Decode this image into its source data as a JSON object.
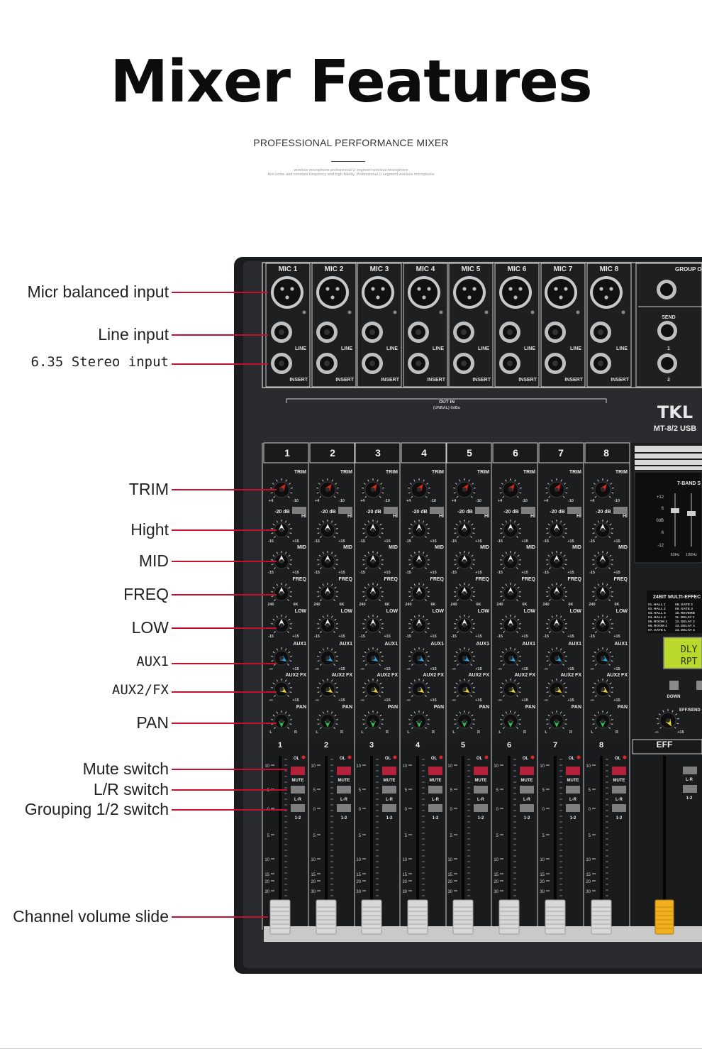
{
  "header": {
    "title": "Mixer Features",
    "subtitle": "PROFESSIONAL PERFORMANCE MIXER",
    "tiny_line_1": "wireless microphone professional U segment wireless microphone",
    "tiny_line_2": "Anti noise and constant frequency and high fidelity, Professional U segment wireless microphone"
  },
  "callouts": [
    {
      "label": "Micr balanced input"
    },
    {
      "label": "Line input"
    },
    {
      "label": "6.35 Stereo input"
    },
    {
      "label": "TRIM"
    },
    {
      "label": "Hight"
    },
    {
      "label": "MID"
    },
    {
      "label": "FREQ"
    },
    {
      "label": "LOW"
    },
    {
      "label": "AUX1"
    },
    {
      "label": "AUX2/FX"
    },
    {
      "label": "PAN"
    },
    {
      "label": "Mute switch"
    },
    {
      "label": "L/R switch"
    },
    {
      "label": "Grouping 1/2 switch"
    },
    {
      "label": "Channel volume slide"
    }
  ],
  "mixer": {
    "brand": "TKL",
    "model": "MT-8/2 USB",
    "mic_labels": [
      "MIC 1",
      "MIC 2",
      "MIC 3",
      "MIC 4",
      "MIC 5",
      "MIC 6",
      "MIC 7",
      "MIC 8"
    ],
    "channel_numbers": [
      "1",
      "2",
      "3",
      "4",
      "5",
      "6",
      "7",
      "8"
    ],
    "line_label": "LINE",
    "insert_label": "INSERT",
    "group_out_label": "GROUP O",
    "send_label": "SEND",
    "send_numbers": [
      "1",
      "2"
    ],
    "out_label": "OUT IN",
    "unbal_label": "(UNBAL) 0dBu",
    "trim_label": "TRIM",
    "trim_min": "+4",
    "trim_max": "-10",
    "pad_label": "-20 dB",
    "hi_label": "HI",
    "mid_label": "MID",
    "freq_label": "FREQ",
    "low_label": "LOW",
    "aux1_label": "AUX1",
    "aux2_label": "AUX2 FX",
    "pan_label": "PAN",
    "eq_min": "-15",
    "eq_max": "+15",
    "freq_min": "240",
    "freq_max": "6K",
    "aux_min": "-∞",
    "pan_l": "L",
    "pan_r": "R",
    "ol_label": "OL",
    "mute_label": "MUTE",
    "lr_label": "L-R",
    "group_label": "1-2",
    "fader_scale": [
      "10",
      "5",
      "0",
      "5",
      "10",
      "15",
      "20",
      "30"
    ],
    "eff_label": "EFF",
    "eq7_label": "7-BAND S",
    "eq7_scale": [
      "+12",
      "6",
      "0dB",
      "6",
      "-12"
    ],
    "eq7_freqs": [
      "63Hz",
      "100Hz"
    ],
    "effects_title": "24BIT MULTI-EFFEC",
    "effects_col1": [
      "01. HALL 1",
      "02. HALL 2",
      "03. HALL 3",
      "04. HALL 4",
      "05. ROOM 1",
      "06. ROOM 2",
      "07. GATE 1"
    ],
    "effects_col2": [
      "08. GATE 2",
      "09. GATE 3",
      "10. REVERB",
      "11. DELAY 1",
      "12. DELAY 2",
      "13. DELAY 3",
      "14. DELAY 4"
    ],
    "lcd_line1": "DLY",
    "lcd_line2": "RPT",
    "down_label": "DOWN",
    "eff_send_label": "EFF/SEND",
    "colors": {
      "trim": "#d8261c",
      "eq": "#f0f0f0",
      "aux1": "#29a6dc",
      "aux2": "#e2d43a",
      "pan": "#2ec452",
      "mute": "#b3223a",
      "eff_fader": "#f0b020",
      "lcd": "#b8d82c"
    }
  }
}
